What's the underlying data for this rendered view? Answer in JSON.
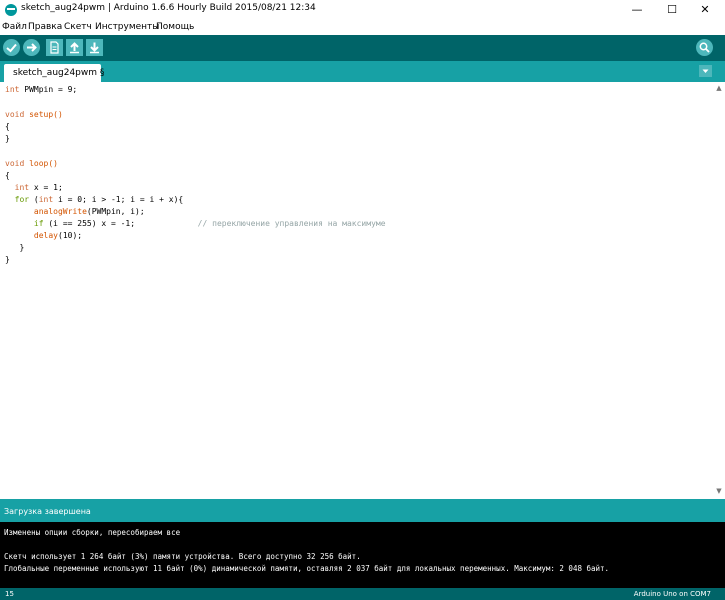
{
  "window": {
    "title": "sketch_aug24pwm | Arduino 1.6.6 Hourly Build 2015/08/21 12:34",
    "minimize": "—",
    "maximize": "☐",
    "close": "✕"
  },
  "menu": [
    "Файл",
    "Правка",
    "Скетч",
    "Инструменты",
    "Помощь"
  ],
  "toolbar": {
    "buttons": [
      "verify-icon",
      "upload-icon",
      "new-icon",
      "open-icon",
      "save-icon"
    ],
    "serial_monitor": "serial-monitor-icon"
  },
  "tab": {
    "label": "sketch_aug24pwm §"
  },
  "code": {
    "l1_type": "int",
    "l1_rest": " PWMpin = 9;",
    "l3_type": "void",
    "l3_rest": " setup()",
    "l4": "{",
    "l5": "}",
    "l7_type": "void",
    "l7_rest": " loop()",
    "l8": "{",
    "l9_indent": "  ",
    "l9_type": "int",
    "l9_rest": " x = 1;",
    "l10_indent": "  ",
    "l10_ctrl": "for",
    "l10_a": " (",
    "l10_type": "int",
    "l10_rest": " i = 0; i > -1; i = i + x){",
    "l11_indent": "      ",
    "l11_func": "analogWrite",
    "l11_rest": "(PWMpin, i);",
    "l12_indent": "      ",
    "l12_ctrl": "if",
    "l12_rest": " (i == 255) x = -1;             ",
    "l12_comment": "// переключение управления на максимуме",
    "l13_indent": "      ",
    "l13_func": "delay",
    "l13_rest": "(10);",
    "l14": "   }",
    "l15": "}"
  },
  "status": {
    "message": "Загрузка завершена"
  },
  "console": {
    "line1": "Изменены опции сборки, пересобираем все",
    "line2": "Скетч использует 1 264 байт (3%) памяти устройства. Всего доступно 32 256 байт.",
    "line3": "Глобальные переменные используют 11 байт (0%) динамической памяти, оставляя 2 037 байт для локальных переменных. Максимум: 2 048 байт."
  },
  "footer": {
    "line_number": "15",
    "board": "Arduino Uno on COM7"
  },
  "colors": {
    "toolbar": "#006468",
    "tabbar": "#17a1a5",
    "button": "#4db7bb",
    "keyword_type": "#cc6633",
    "keyword_control": "#669900",
    "function": "#d35400",
    "comment": "#95a5a6"
  }
}
